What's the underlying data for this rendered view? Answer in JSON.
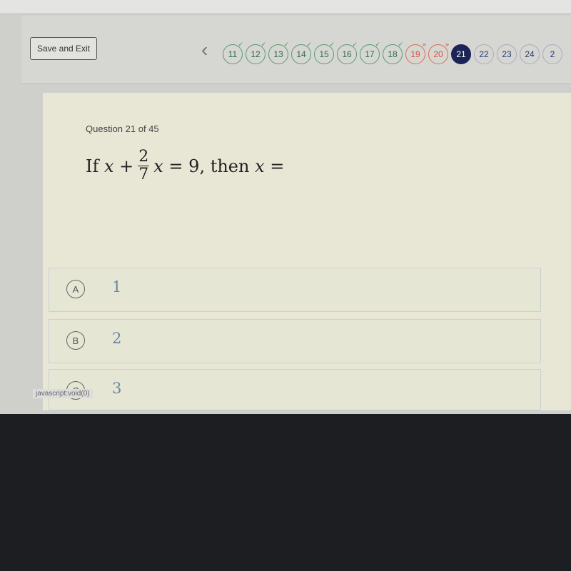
{
  "header": {
    "save_label": "Save and Exit",
    "questions": [
      {
        "n": "11",
        "status": "answered"
      },
      {
        "n": "12",
        "status": "answered"
      },
      {
        "n": "13",
        "status": "answered"
      },
      {
        "n": "14",
        "status": "answered"
      },
      {
        "n": "15",
        "status": "answered"
      },
      {
        "n": "16",
        "status": "answered"
      },
      {
        "n": "17",
        "status": "answered"
      },
      {
        "n": "18",
        "status": "answered"
      },
      {
        "n": "19",
        "status": "flagged"
      },
      {
        "n": "20",
        "status": "flagged"
      },
      {
        "n": "21",
        "status": "current"
      },
      {
        "n": "22",
        "status": "unanswered"
      },
      {
        "n": "23",
        "status": "unanswered"
      },
      {
        "n": "24",
        "status": "unanswered"
      },
      {
        "n": "2",
        "status": "unanswered"
      }
    ]
  },
  "question": {
    "counter": "Question 21 of 45",
    "prefix": "If 𝑥 +",
    "num": "2",
    "den": "7",
    "suffix": "𝑥 = 9,  then 𝑥 ="
  },
  "choices": [
    {
      "letter": "A",
      "value": "1"
    },
    {
      "letter": "B",
      "value": "2"
    },
    {
      "letter": "C",
      "value": "3"
    }
  ],
  "status_bar": "javascript:void(0)",
  "colors": {
    "answered": "#5a9a70",
    "flagged": "#e06a58",
    "current": "#1c2456"
  }
}
